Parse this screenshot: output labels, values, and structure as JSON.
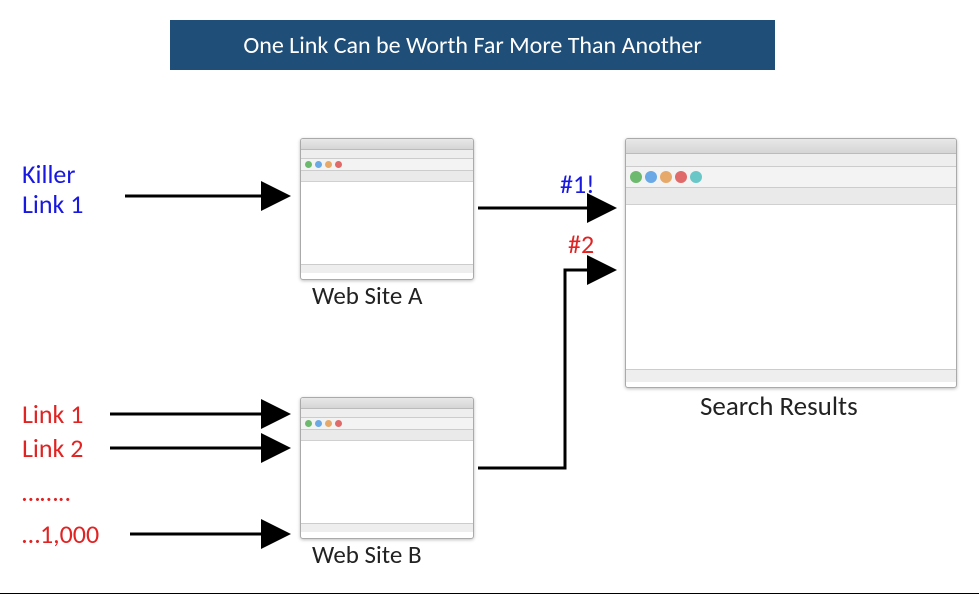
{
  "title": "One Link Can be Worth Far More Than Another",
  "killer": {
    "line1": "Killer",
    "line2": "Link 1"
  },
  "links": {
    "l1": "Link 1",
    "l2": "Link 2",
    "dots": "……..",
    "l1000": "…1,000"
  },
  "siteA": "Web Site A",
  "siteB": "Web Site B",
  "search": "Search Results",
  "rank1": "#1!",
  "rank2": "#2",
  "colors": {
    "banner": "#1f4e79",
    "blue": "#1818e0",
    "red": "#e02424",
    "icon_green": "#6db96d",
    "icon_blue": "#6aa9e6",
    "icon_orange": "#e6a96a",
    "icon_red": "#e06a6a",
    "icon_teal": "#6ac7c7"
  }
}
